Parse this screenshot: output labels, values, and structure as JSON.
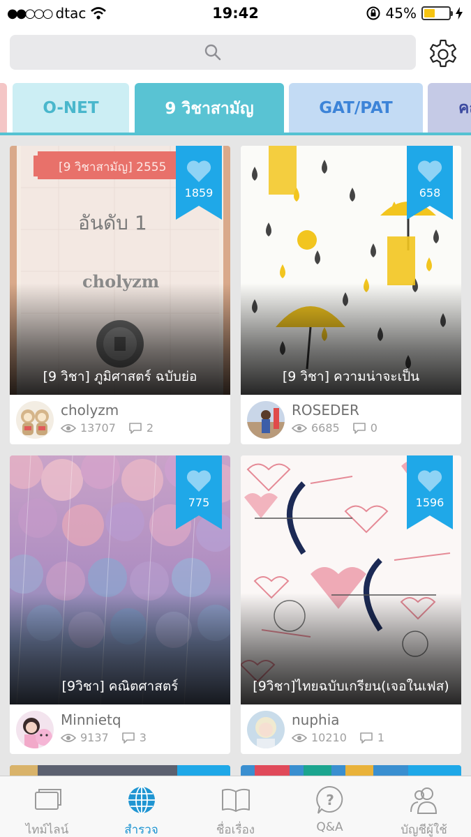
{
  "status_bar": {
    "carrier": "dtac",
    "time": "19:42",
    "battery": "45%",
    "battery_level": 0.45
  },
  "search": {
    "placeholder": ""
  },
  "tabs": [
    {
      "label": ""
    },
    {
      "label": "O-NET"
    },
    {
      "label": "9 วิชาสามัญ",
      "active": true
    },
    {
      "label": "GAT/PAT"
    },
    {
      "label": "คณ"
    }
  ],
  "cards": [
    {
      "title": "[9 วิชา] ภูมิศาสตร์ ฉบับย่อ",
      "likes": "1859",
      "author": "cholyzm",
      "views": "13707",
      "comments": "2",
      "cover_text": {
        "banner": "[9 วิชาสามัญ] 2555",
        "rank": "อันดับ 1",
        "name": "cholyzm"
      }
    },
    {
      "title": "[9 วิชา] ความน่าจะเป็น",
      "likes": "658",
      "author": "ROSEDER",
      "views": "6685",
      "comments": "0"
    },
    {
      "title": "[9วิชา] คณิตศาสตร์",
      "likes": "775",
      "author": "Minnietq",
      "views": "9137",
      "comments": "3"
    },
    {
      "title": "[9วิชา]ไทยฉบับเกรียน(เจอในเฟส)",
      "likes": "1596",
      "author": "nuphia",
      "views": "10210",
      "comments": "1"
    }
  ],
  "bottom_nav": [
    {
      "label": "ไทม์ไลน์",
      "icon": "timeline-icon"
    },
    {
      "label": "สำรวจ",
      "icon": "globe-icon",
      "active": true
    },
    {
      "label": "ชื่อเรื่อง",
      "icon": "book-icon"
    },
    {
      "label": "Q&A",
      "icon": "question-icon"
    },
    {
      "label": "บัญชีผู้ใช้",
      "icon": "account-icon"
    }
  ],
  "colors": {
    "accent": "#1fa8e8",
    "tab_active": "#59c3d3",
    "nav_active": "#1f95d2"
  }
}
